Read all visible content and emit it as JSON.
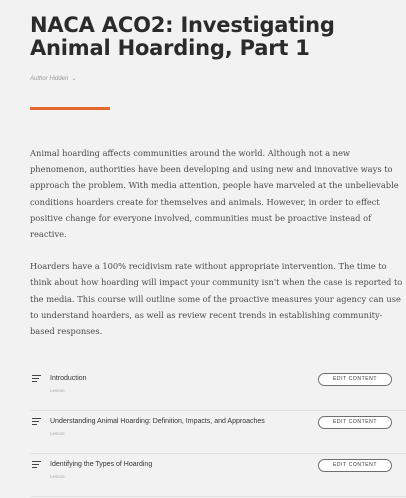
{
  "course": {
    "title": "NACA ACO2: Investigating Animal Hoarding, Part 1",
    "author_label": "Author Hidden",
    "author_chevron_icon": "chevron-down-icon"
  },
  "colors": {
    "accent": "#e8672e",
    "background": "#f2f2f2",
    "title": "#2b2b2b",
    "body_text": "#4a4a4a"
  },
  "description": {
    "paragraph_1_lines": [
      "Animal hoarding affects communities around the world. Although not a new",
      "phenomenon, authorities have been developing and using new and innovative ways to",
      "approach the problem. With media attention, people have marveled at the unbelievable",
      "conditions hoarders create for themselves and animals. However, in order to effect",
      "positive change for everyone involved, communities must be proactive instead of",
      "reactive."
    ],
    "paragraph_2_lines": [
      "Hoarders have a 100% recidivism rate without appropriate intervention. The time to",
      "think about how hoarding will impact your community isn't when the case is reported to",
      "the media. This course will outline some of the proactive measures your agency can use",
      "to understand hoarders, as well as review recent trends in establishing community-",
      "based responses."
    ]
  },
  "lessons": [
    {
      "title": "Introduction",
      "type": "Lesson",
      "button_label": "EDIT CONTENT",
      "icon": "lesson-list-icon"
    },
    {
      "title": "Understanding Animal Hoarding: Definition, Impacts, and Approaches",
      "type": "Lesson",
      "button_label": "EDIT CONTENT",
      "icon": "lesson-list-icon"
    },
    {
      "title": "Identifying the Types of Hoarding",
      "type": "Lesson",
      "button_label": "EDIT CONTENT",
      "icon": "lesson-list-icon"
    }
  ]
}
